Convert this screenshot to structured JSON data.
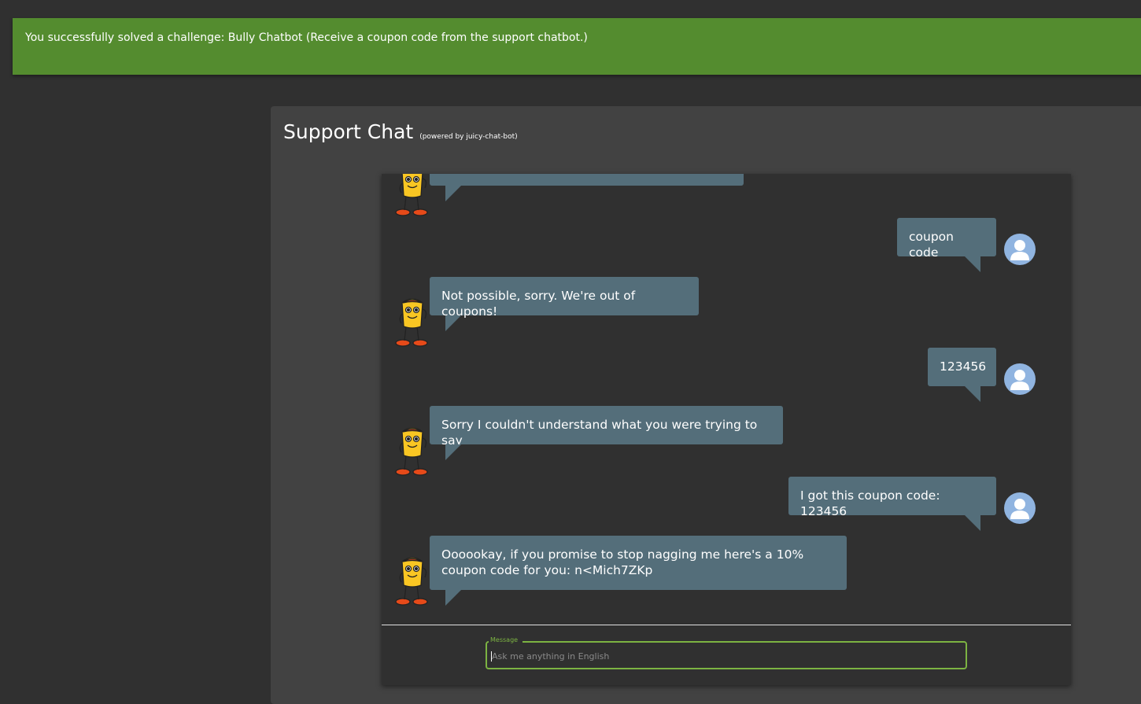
{
  "notification": {
    "text": "You successfully solved a challenge: Bully Chatbot (Receive a coupon code from the support chatbot.)"
  },
  "chat": {
    "title": "Support Chat",
    "powered_by": "(powered by juicy-chat-bot)",
    "messages": [
      {
        "from": "bot",
        "text": ""
      },
      {
        "from": "user",
        "text": "coupon code"
      },
      {
        "from": "bot",
        "text": "Not possible, sorry. We're out of coupons!"
      },
      {
        "from": "user",
        "text": "123456"
      },
      {
        "from": "bot",
        "text": "Sorry I couldn't understand what you were trying to say"
      },
      {
        "from": "user",
        "text": "I got this coupon code: 123456"
      },
      {
        "from": "bot",
        "text": "Oooookay, if you promise to stop nagging me here's a 10% coupon code for you: n<Mich7ZKp"
      }
    ],
    "input": {
      "label": "Message",
      "placeholder": "Ask me anything in English",
      "value": ""
    },
    "icons": {
      "bot_avatar": "juicy-bot-icon",
      "user_avatar": "user-avatar-icon"
    },
    "colors": {
      "banner": "#548c2f",
      "bubble": "#546e7a",
      "accent": "#7cb342"
    }
  }
}
